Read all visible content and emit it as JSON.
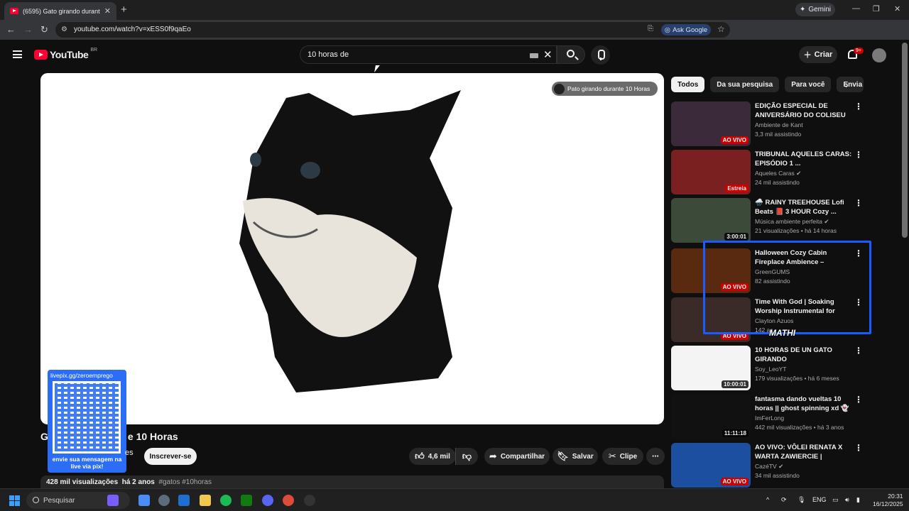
{
  "browser": {
    "tab_title": "(6595) Gato girando durante 10",
    "new_tab": "+",
    "gemini_label": "Gemini",
    "url": "youtube.com/watch?v=xESS0f9qaEo",
    "ask_google": "Ask Google"
  },
  "youtube": {
    "logo_text": "YouTube",
    "country_code": "BR",
    "search_value": "10 horas de",
    "create_label": "Criar",
    "notifications_badge": "9+"
  },
  "player": {
    "channel_chip": "Pato girando durante 10 Horas",
    "qr_top": "livepix.gg/zeroemprego",
    "qr_bottom": "envie sua mensagem na live via pix!"
  },
  "video": {
    "title_start": "G",
    "title_end": "e 10 Horas",
    "channel_name_fragment": "10 I\nMI",
    "subs_fragment": "es",
    "subscribe": "Inscrever-se",
    "likes": "4,6 mil",
    "share": "Compartilhar",
    "save": "Salvar",
    "clip": "Clipe",
    "views": "428 mil visualizações",
    "age": "há 2 anos",
    "tags": "#gatos #10horas"
  },
  "sidebar": {
    "chips": [
      "Todos",
      "Da sua pesquisa",
      "Para você",
      "Envia"
    ],
    "items": [
      {
        "title": "EDIÇÃO ESPECIAL DE ANIVERSÁRIO DO COLISEU [S...",
        "channel": "Ambiente de Kant",
        "meta": "3,3 mil assistindo",
        "badge": "AO VIVO",
        "badge_type": "live",
        "thumb": "#3b2a3a"
      },
      {
        "title": "TRIBUNAL AQUELES CARAS: EPISÓDIO 1 ...",
        "channel": "Aqueles Caras ✔",
        "meta": "24 mil assistindo",
        "badge": "Estreia",
        "badge_type": "live",
        "thumb": "#7a2020"
      },
      {
        "title": "🌧️ RAINY TREEHOUSE Lofi Beats 📕 3 HOUR Cozy ...",
        "channel": "Música ambiente perfeita ✔",
        "meta": "21 visualizações • há 14 horas",
        "badge": "3:00:01",
        "badge_type": "dur",
        "thumb": "#3c4a3a"
      },
      {
        "title": "Halloween Cozy Cabin Fireplace Ambience – Crackling Fire & ...",
        "channel": "GreenGUMS",
        "meta": "82 assistindo",
        "badge": "AO VIVO",
        "badge_type": "live",
        "thumb": "#5a2a10"
      },
      {
        "title": "Time With God | Soaking Worship Instrumental for Pray...",
        "channel": "Clayton Azuos",
        "meta": "142 as",
        "badge": "AO VIVO",
        "badge_type": "live",
        "thumb": "#3a2a28"
      },
      {
        "title": "10 HORAS DE UN GATO GIRANDO",
        "channel": "Soy_LeoYT",
        "meta": "179 visualizações • há 6 meses",
        "badge": "10:00:01",
        "badge_type": "dur",
        "thumb": "#f4f4f4"
      },
      {
        "title": "fantasma dando vueltas 10 horas || ghost spinning xd 👻",
        "channel": "ImFerLong",
        "meta": "442 mil visualizações • há 3 anos",
        "badge": "11:11:18",
        "badge_type": "dur",
        "thumb": "#111111"
      },
      {
        "title": "AO VIVO: VÔLEI RENATA X WARTA ZAWIERCIE | MUNDIA...",
        "channel": "CazéTV ✔",
        "meta": "34 mil assistindo",
        "badge": "AO VIVO",
        "badge_type": "live",
        "thumb": "#1d4fa0"
      }
    ],
    "highlight_label": "MATHI"
  },
  "taskbar": {
    "search_placeholder": "Pesquisar",
    "lang": "ENG",
    "time": "20:31",
    "date": "16/12/2025"
  }
}
